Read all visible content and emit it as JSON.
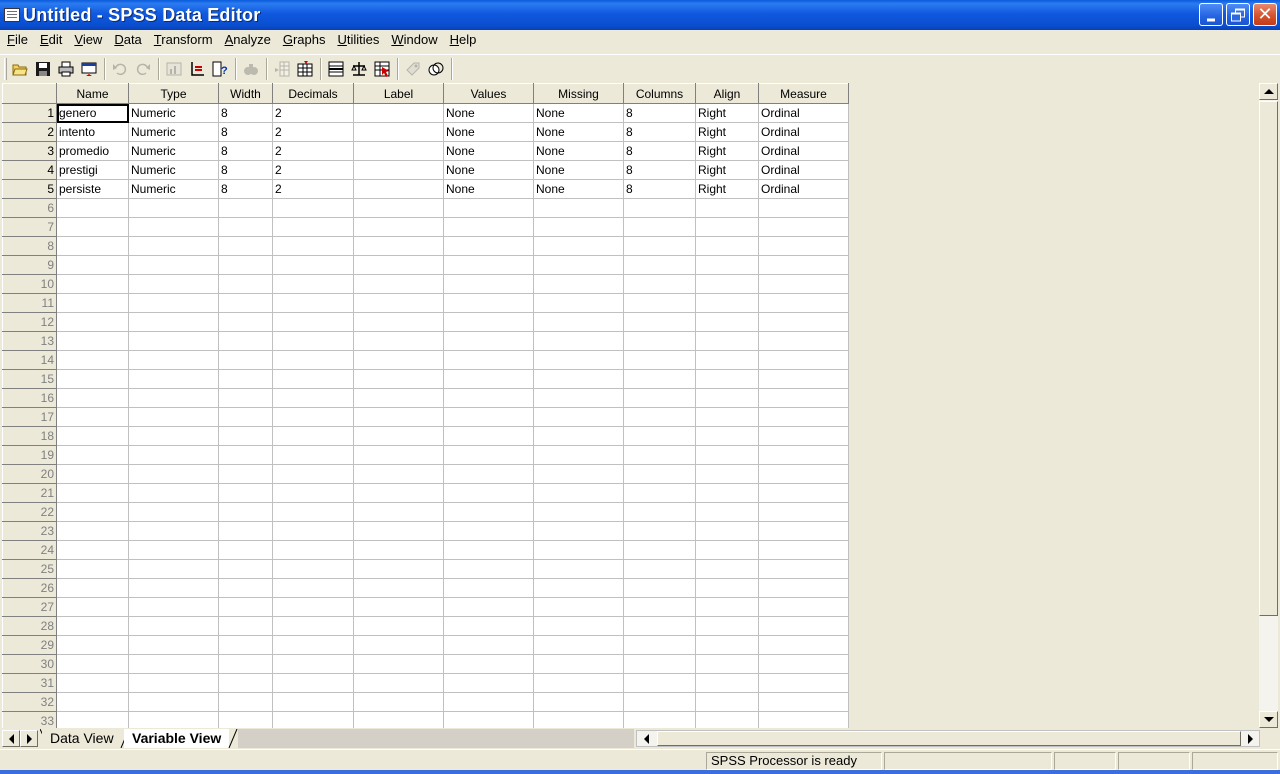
{
  "window": {
    "title": "Untitled - SPSS Data Editor"
  },
  "menu": [
    {
      "label": "File"
    },
    {
      "label": "Edit"
    },
    {
      "label": "View"
    },
    {
      "label": "Data"
    },
    {
      "label": "Transform"
    },
    {
      "label": "Analyze"
    },
    {
      "label": "Graphs"
    },
    {
      "label": "Utilities"
    },
    {
      "label": "Window"
    },
    {
      "label": "Help"
    }
  ],
  "toolbar": {
    "buttons": [
      {
        "icon": "open-folder-icon",
        "enabled": true
      },
      {
        "icon": "save-icon",
        "enabled": true
      },
      {
        "icon": "print-icon",
        "enabled": true
      },
      {
        "icon": "dialog-recall-icon",
        "enabled": true
      },
      {
        "icon": "undo-icon",
        "enabled": false
      },
      {
        "icon": "redo-icon",
        "enabled": false
      },
      {
        "icon": "goto-chart-icon",
        "enabled": false
      },
      {
        "icon": "goto-case-icon",
        "enabled": true
      },
      {
        "icon": "variables-icon",
        "enabled": true
      },
      {
        "icon": "find-icon",
        "enabled": false
      },
      {
        "icon": "insert-cases-icon",
        "enabled": false
      },
      {
        "icon": "insert-variable-icon",
        "enabled": true
      },
      {
        "icon": "split-file-icon",
        "enabled": true
      },
      {
        "icon": "weight-cases-icon",
        "enabled": true
      },
      {
        "icon": "select-cases-icon",
        "enabled": true
      },
      {
        "icon": "value-labels-icon",
        "enabled": false
      },
      {
        "icon": "use-sets-icon",
        "enabled": true
      }
    ]
  },
  "grid": {
    "columns": [
      "Name",
      "Type",
      "Width",
      "Decimals",
      "Label",
      "Values",
      "Missing",
      "Columns",
      "Align",
      "Measure"
    ],
    "rows": [
      [
        "genero",
        "Numeric",
        "8",
        "2",
        "",
        "None",
        "None",
        "8",
        "Right",
        "Ordinal"
      ],
      [
        "intento",
        "Numeric",
        "8",
        "2",
        "",
        "None",
        "None",
        "8",
        "Right",
        "Ordinal"
      ],
      [
        "promedio",
        "Numeric",
        "8",
        "2",
        "",
        "None",
        "None",
        "8",
        "Right",
        "Ordinal"
      ],
      [
        "prestigi",
        "Numeric",
        "8",
        "2",
        "",
        "None",
        "None",
        "8",
        "Right",
        "Ordinal"
      ],
      [
        "persiste",
        "Numeric",
        "8",
        "2",
        "",
        "None",
        "None",
        "8",
        "Right",
        "Ordinal"
      ]
    ],
    "row_numbers": [
      "1",
      "2",
      "3",
      "4",
      "5",
      "6",
      "7",
      "8",
      "9",
      "10",
      "11",
      "12",
      "13",
      "14",
      "15",
      "16",
      "17",
      "18",
      "19",
      "20",
      "21",
      "22",
      "23",
      "24",
      "25",
      "26",
      "27",
      "28",
      "29",
      "30",
      "31",
      "32",
      "33"
    ]
  },
  "tabs": {
    "data_view": "Data View",
    "variable_view": "Variable View",
    "active": "Variable View"
  },
  "status": {
    "processor": "SPSS Processor  is ready"
  }
}
